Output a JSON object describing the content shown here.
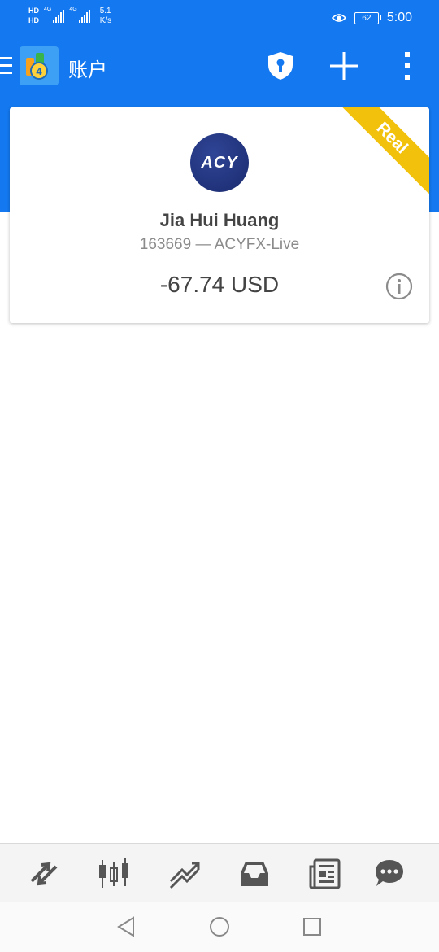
{
  "status_bar": {
    "hd1": "HD",
    "hd2": "HD",
    "net1": "4G",
    "net2": "4G",
    "speed_value": "5.1",
    "speed_unit": "K/s",
    "battery": "62",
    "time": "5:00"
  },
  "header": {
    "title": "账户"
  },
  "account_card": {
    "badge": "Real",
    "broker_logo_text": "ACY",
    "name": "Jia Hui Huang",
    "subtitle": "163669 — ACYFX-Live",
    "balance": "-67.74 USD"
  },
  "icons": {
    "menu": "menu-icon",
    "app_logo": "metatrader-logo",
    "shield": "shield-keyhole-icon",
    "add": "plus-icon",
    "more": "more-vertical-icon",
    "info": "info-icon",
    "nav": [
      "quotes-arrows-icon",
      "candlestick-chart-icon",
      "trade-chart-icon",
      "inbox-icon",
      "news-icon",
      "chat-icon"
    ],
    "system": [
      "back-triangle-icon",
      "home-circle-icon",
      "recents-square-icon"
    ]
  },
  "colors": {
    "primary": "#1479f0",
    "badge": "#f2c10c",
    "broker": "#22337a",
    "text_dark": "#444444",
    "text_muted": "#8b8b8b",
    "nav_icon": "#555555"
  }
}
